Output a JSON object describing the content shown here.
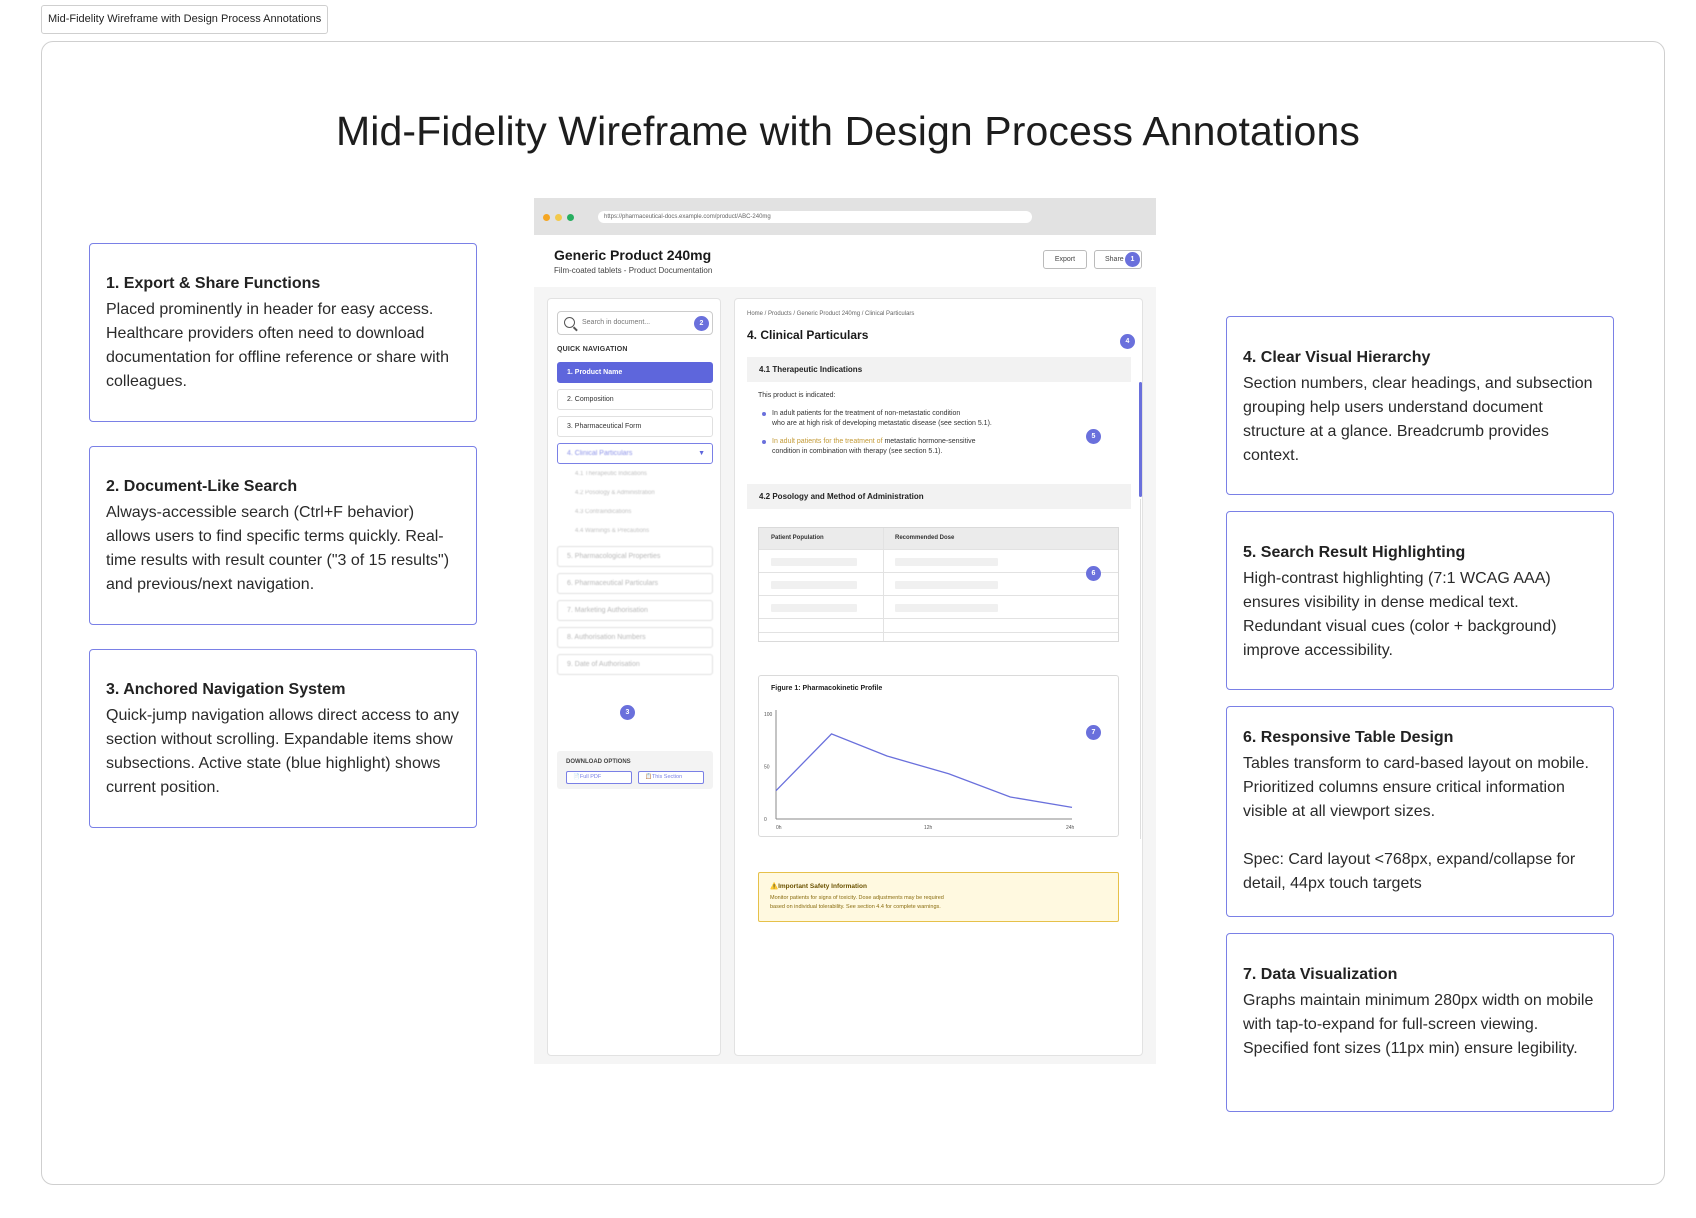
{
  "tab_label": "Mid-Fidelity Wireframe with Design Process Annotations",
  "title": "Mid-Fidelity Wireframe with Design Process Annotations",
  "accent_color": "#6a70dc",
  "annotations": [
    {
      "heading": "1. Export & Share Functions",
      "body": "Placed prominently in header for easy access. Healthcare providers often need to download documentation for offline reference or share with colleagues."
    },
    {
      "heading": "2. Document-Like Search",
      "body": "Always-accessible search (Ctrl+F behavior) allows users to find specific terms quickly. Real-time results with result counter (\"3 of 15 results\") and previous/next navigation."
    },
    {
      "heading": "3. Anchored Navigation System",
      "body": "Quick-jump navigation allows direct access to any section without scrolling. Expandable items show subsections. Active state (blue highlight) shows current position."
    },
    {
      "heading": "4. Clear Visual Hierarchy",
      "body": "Section numbers, clear headings, and subsection grouping help users understand document structure at a glance. Breadcrumb provides context."
    },
    {
      "heading": "5. Search Result Highlighting",
      "body": "High-contrast highlighting (7:1 WCAG AAA) ensures visibility in dense medical text. Redundant visual cues (color + background) improve accessibility."
    },
    {
      "heading": "6. Responsive Table Design",
      "body": "Tables transform to card-based layout on mobile. Prioritized columns ensure critical information visible at all viewport sizes.",
      "spec": "Spec: Card layout <768px, expand/collapse for detail, 44px touch targets"
    },
    {
      "heading": "7. Data Visualization",
      "body": "Graphs maintain minimum 280px width on mobile with tap-to-expand for full-screen viewing. Specified font sizes (11px min) ensure legibility."
    }
  ],
  "wireframe": {
    "url": "https://pharmaceutical-docs.example.com/product/ABC-240mg",
    "product_title": "Generic Product 240mg",
    "product_subtitle": "Film-coated tablets - Product Documentation",
    "export_label": "Export",
    "share_label": "Share",
    "badges": [
      "1",
      "2",
      "3",
      "4",
      "5",
      "6",
      "7"
    ],
    "search_placeholder": "Search in document...",
    "quick_nav_label": "QUICK NAVIGATION",
    "nav_items": [
      "1. Product Name",
      "2. Composition",
      "3. Pharmaceutical Form",
      "4. Clinical Particulars",
      "5. Pharmacological Properties",
      "6. Pharmaceutical Particulars",
      "7. Marketing Authorisation",
      "8. Authorisation Numbers",
      "9. Date of Authorisation"
    ],
    "sub_items": [
      "4.1 Therapeutic Indications",
      "4.2 Posology & Administration",
      "4.3 Contraindications",
      "4.4 Warnings & Precautions"
    ],
    "download_label": "DOWNLOAD OPTIONS",
    "download_full": "Full PDF",
    "download_section": "This Section",
    "breadcrumb": "Home / Products / Generic Product 240mg / Clinical Particulars",
    "section_title": "4. Clinical Particulars",
    "sub1_title": "4.1 Therapeutic Indications",
    "indicated_text": "This product is indicated:",
    "bullet1_line1": "In adult patients for the treatment of non-metastatic condition",
    "bullet1_line2": "who are at high risk of developing metastatic disease (see section 5.1).",
    "bullet2_hl": "In adult patients for the treatment of",
    "bullet2_rest": " metastatic hormone-sensitive",
    "bullet2_line2": "condition in combination with therapy (see section 5.1).",
    "sub2_title": "4.2 Posology and Method of Administration",
    "table_headers": [
      "Patient Population",
      "Recommended Dose"
    ],
    "figure_title": "Figure 1: Pharmacokinetic Profile",
    "alert_title": "Important Safety Information",
    "alert_line1": "Monitor patients for signs of toxicity. Dose adjustments may be required",
    "alert_line2": "based on individual tolerability. See section 4.4 for complete warnings.",
    "window_dot_colors": [
      "#f5a623",
      "#f2c94c",
      "#27ae60"
    ],
    "alert_icon": "warning-icon"
  },
  "chart_data": {
    "type": "line",
    "title": "Figure 1: Pharmacokinetic Profile",
    "x_tick_labels": [
      "0h",
      "12h",
      "24h"
    ],
    "y_tick_labels": [
      "0",
      "50",
      "100"
    ],
    "ylim": [
      0,
      100
    ],
    "xlim": [
      0,
      24
    ],
    "series": [
      {
        "x": [
          0,
          4.5,
          9,
          14,
          19,
          24
        ],
        "values": [
          27,
          81,
          60,
          43,
          21,
          11
        ]
      }
    ]
  }
}
